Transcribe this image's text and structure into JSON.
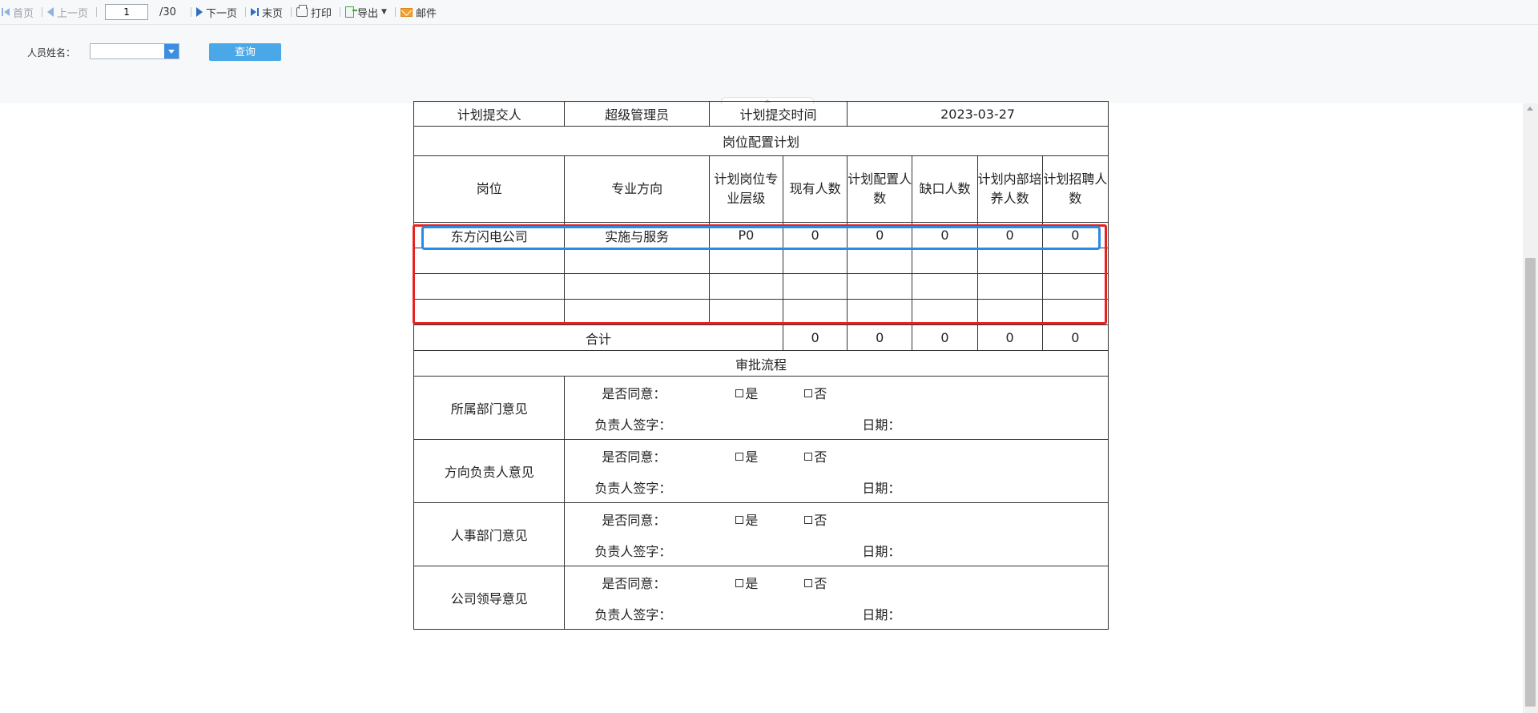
{
  "toolbar": {
    "first": "首页",
    "prev": "上一页",
    "page_current": "1",
    "page_total": "/30",
    "next": "下一页",
    "last": "末页",
    "print": "打印",
    "export": "导出",
    "mail": "邮件"
  },
  "query": {
    "label": "人员姓名：",
    "name_value": "",
    "button": "查询"
  },
  "report": {
    "submitter_label": "计划提交人",
    "submitter_value": "超级管理员",
    "submit_time_label": "计划提交时间",
    "submit_time_value": "2023-03-27",
    "section_plan": "岗位配置计划",
    "headers": [
      "岗位",
      "专业方向",
      "计划岗位专业层级",
      "现有人数",
      "计划配置人数",
      "缺口人数",
      "计划内部培养人数",
      "计划招聘人数"
    ],
    "rows": [
      [
        "东方闪电公司",
        "实施与服务",
        "P0",
        "0",
        "0",
        "0",
        "0",
        "0"
      ],
      [
        "",
        "",
        "",
        "",
        "",
        "",
        "",
        ""
      ],
      [
        "",
        "",
        "",
        "",
        "",
        "",
        "",
        ""
      ],
      [
        "",
        "",
        "",
        "",
        "",
        "",
        "",
        ""
      ]
    ],
    "total_label": "合计",
    "totals": [
      "0",
      "0",
      "0",
      "0",
      "0"
    ],
    "section_approval": "审批流程",
    "approval_agree_label": "是否同意：",
    "approval_yes": "是",
    "approval_no": "否",
    "approval_sign_label": "负责人签字：",
    "approval_date_label": "日期：",
    "approvals": [
      "所属部门意见",
      "方向负责人意见",
      "人事部门意见",
      "公司领导意见"
    ]
  },
  "colors": {
    "highlight_red": "#e8231f",
    "highlight_blue": "#2a8ae6",
    "query_button": "#4aa8e8"
  }
}
